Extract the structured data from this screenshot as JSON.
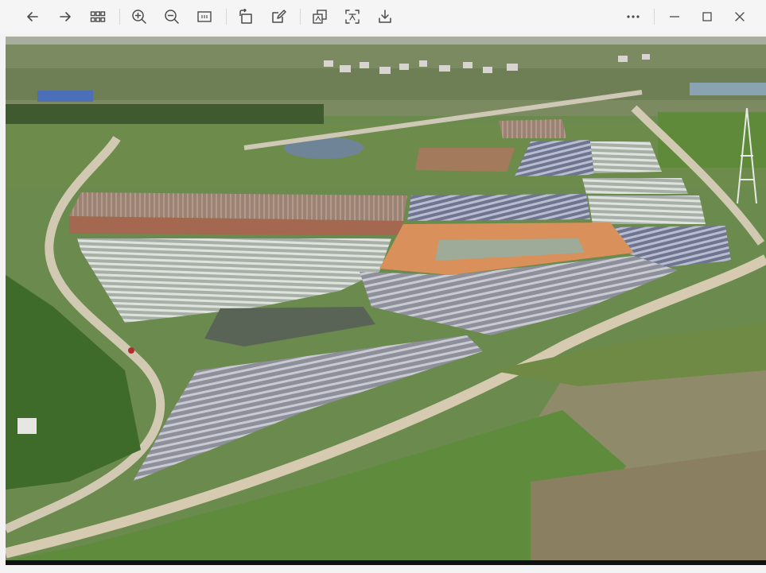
{
  "toolbar": {
    "icons": [
      "arrow-left-icon",
      "arrow-right-icon",
      "grid-icon",
      "zoom-in-icon",
      "zoom-out-icon",
      "fit-icon",
      "rotate-icon",
      "edit-icon",
      "compare-icon",
      "ocr-icon",
      "download-icon",
      "more-icon",
      "minimize-icon",
      "maximize-icon",
      "close-icon"
    ]
  },
  "image": {
    "subject": "aerial farmland"
  },
  "colors": {
    "toolbar_bg": "#f5f5f5",
    "icon": "#4a4a4a"
  }
}
